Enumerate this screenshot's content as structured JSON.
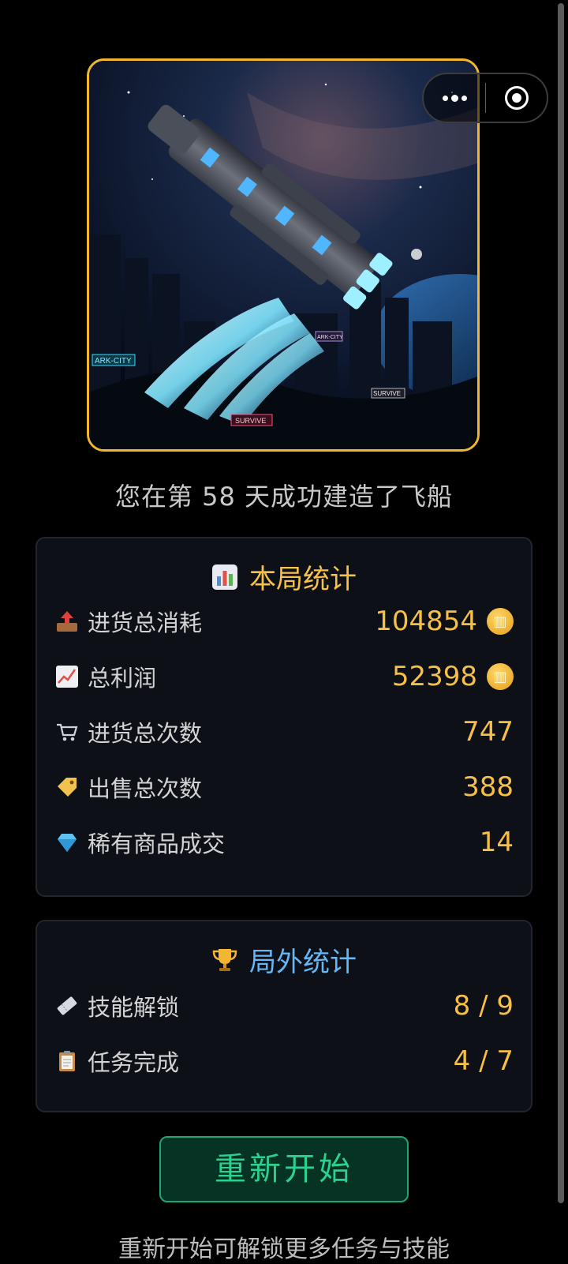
{
  "colors": {
    "accent_gold": "#f6bf45",
    "accent_blue": "#67b6f5",
    "accent_green": "#2ad18f",
    "frame": "#f2b730"
  },
  "hero": {
    "image": "spaceship-launch-illustration",
    "signs": [
      "ARK-CITY",
      "SURVIVE",
      "ARK-CITY",
      "SURVIVE"
    ]
  },
  "capsule": {
    "more_icon": "more-dots-icon",
    "close_icon": "target-icon"
  },
  "subtitle": "您在第 58 天成功建造了飞船",
  "local_stats": {
    "title": "本局统计",
    "title_icon": "bar-chart-icon",
    "rows": [
      {
        "icon": "outbox-tray-icon",
        "label": "进货总消耗",
        "value": "104854",
        "coin": true
      },
      {
        "icon": "chart-increasing-icon",
        "label": "总利润",
        "value": "52398",
        "coin": true
      },
      {
        "icon": "shopping-cart-icon",
        "label": "进货总次数",
        "value": "747"
      },
      {
        "icon": "price-tag-icon",
        "label": "出售总次数",
        "value": "388"
      },
      {
        "icon": "gem-icon",
        "label": "稀有商品成交",
        "value": "14"
      }
    ]
  },
  "global_stats": {
    "title": "局外统计",
    "title_icon": "trophy-icon",
    "rows": [
      {
        "icon": "ticket-icon",
        "label": "技能解锁",
        "value": "8 / 9"
      },
      {
        "icon": "clipboard-icon",
        "label": "任务完成",
        "value": "4 / 7"
      }
    ]
  },
  "restart_button": "重新开始",
  "hint": "重新开始可解锁更多任务与技能"
}
